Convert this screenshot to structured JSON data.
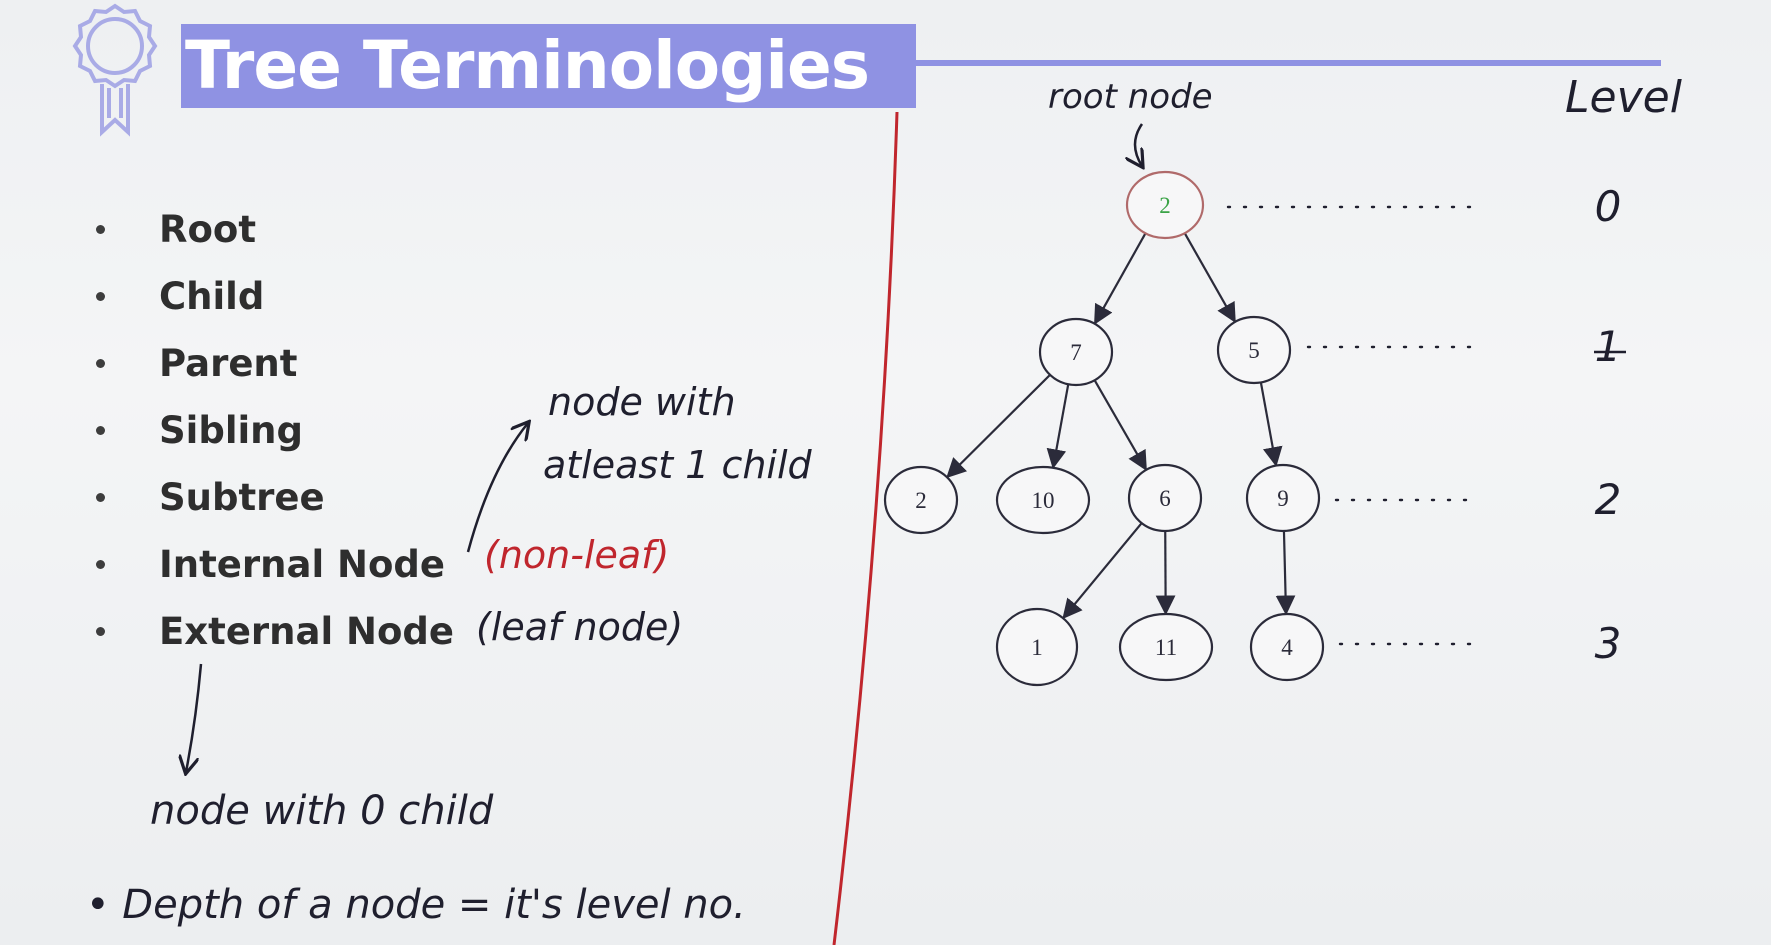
{
  "title": "Tree Terminologies",
  "bullets": [
    "Root",
    "Child",
    "Parent",
    "Sibling",
    "Subtree",
    "Internal Node",
    "External Node"
  ],
  "annotations": {
    "root_node": "root node",
    "level_header": "Level",
    "internal_note_line1": "node with",
    "internal_note_line2": "atleast 1 child",
    "non_leaf": "(non-leaf)",
    "leaf_node": "(leaf node)",
    "zero_child": "node with 0 child",
    "depth_note": "• Depth of a node = it's level no."
  },
  "tree": {
    "nodes": [
      {
        "id": "n0",
        "label": "2",
        "color": "#3aa346"
      },
      {
        "id": "n1",
        "label": "7"
      },
      {
        "id": "n2",
        "label": "5"
      },
      {
        "id": "n3",
        "label": "2"
      },
      {
        "id": "n4",
        "label": "10"
      },
      {
        "id": "n5",
        "label": "6"
      },
      {
        "id": "n6",
        "label": "9"
      },
      {
        "id": "n7",
        "label": "1"
      },
      {
        "id": "n8",
        "label": "11"
      },
      {
        "id": "n9",
        "label": "4"
      }
    ],
    "edges": [
      [
        "n0",
        "n1"
      ],
      [
        "n0",
        "n2"
      ],
      [
        "n1",
        "n3"
      ],
      [
        "n1",
        "n4"
      ],
      [
        "n1",
        "n5"
      ],
      [
        "n2",
        "n6"
      ],
      [
        "n5",
        "n7"
      ],
      [
        "n5",
        "n8"
      ],
      [
        "n6",
        "n9"
      ]
    ],
    "levels": [
      "0",
      "1",
      "2",
      "3"
    ]
  },
  "colors": {
    "banner": "#8f92e3",
    "marker_red": "#c0262d",
    "ink": "#1f1f2e",
    "root_outline": "#b06a6a"
  }
}
